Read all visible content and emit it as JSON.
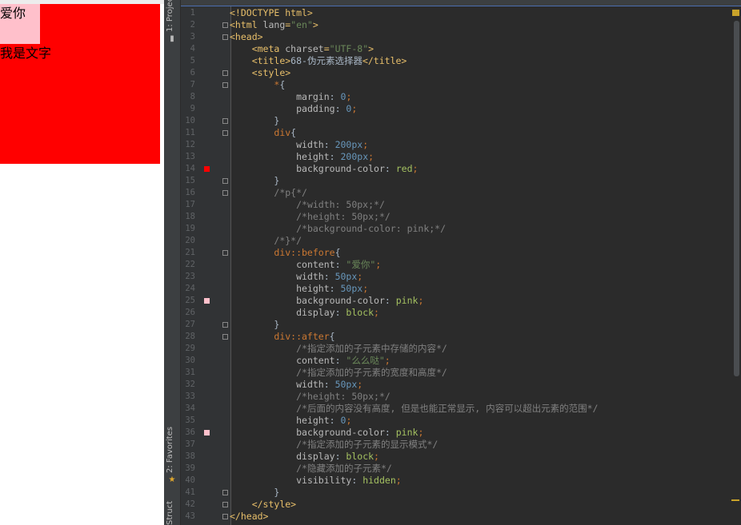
{
  "preview": {
    "before_text": "爱你",
    "div_text": "我是文字"
  },
  "toolstrip": {
    "project_label": "1: Project",
    "favorites_label": "2: Favorites",
    "structure_label": "Structure"
  },
  "colors": {
    "red": "#ff0000",
    "pink": "#ffc0cb"
  },
  "lines": [
    {
      "n": "1",
      "indent": "",
      "tokens": [
        [
          "t-tag",
          "<!DOCTYPE html>"
        ]
      ]
    },
    {
      "n": "2",
      "indent": "",
      "fold": true,
      "tokens": [
        [
          "t-tag",
          "<html "
        ],
        [
          "t-attr",
          "lang"
        ],
        [
          "t-tag",
          "="
        ],
        [
          "t-str",
          "\"en\""
        ],
        [
          "t-tag",
          ">"
        ]
      ]
    },
    {
      "n": "3",
      "indent": "",
      "fold": true,
      "tokens": [
        [
          "t-tag",
          "<head>"
        ]
      ]
    },
    {
      "n": "4",
      "indent": "    ",
      "tokens": [
        [
          "t-tag",
          "<meta "
        ],
        [
          "t-attr",
          "charset"
        ],
        [
          "t-tag",
          "="
        ],
        [
          "t-str",
          "\"UTF-8\""
        ],
        [
          "t-tag",
          ">"
        ]
      ]
    },
    {
      "n": "5",
      "indent": "    ",
      "tokens": [
        [
          "t-tag",
          "<title>"
        ],
        [
          "t-txt",
          "68-伪元素选择器"
        ],
        [
          "t-tag",
          "</title>"
        ]
      ]
    },
    {
      "n": "6",
      "indent": "    ",
      "fold": true,
      "tokens": [
        [
          "t-tag",
          "<style>"
        ]
      ]
    },
    {
      "n": "7",
      "indent": "        ",
      "fold": true,
      "tokens": [
        [
          "t-sel",
          "*"
        ],
        [
          "t-txt",
          "{"
        ]
      ]
    },
    {
      "n": "8",
      "indent": "            ",
      "tokens": [
        [
          "t-prop",
          "margin"
        ],
        [
          "t-txt",
          ": "
        ],
        [
          "t-num",
          "0"
        ],
        [
          "t-punc",
          ";"
        ]
      ]
    },
    {
      "n": "9",
      "indent": "            ",
      "tokens": [
        [
          "t-prop",
          "padding"
        ],
        [
          "t-txt",
          ": "
        ],
        [
          "t-num",
          "0"
        ],
        [
          "t-punc",
          ";"
        ]
      ]
    },
    {
      "n": "10",
      "indent": "        ",
      "fold": true,
      "tokens": [
        [
          "t-txt",
          "}"
        ]
      ]
    },
    {
      "n": "11",
      "indent": "        ",
      "fold": true,
      "tokens": [
        [
          "t-sel",
          "div"
        ],
        [
          "t-txt",
          "{"
        ]
      ]
    },
    {
      "n": "12",
      "indent": "            ",
      "tokens": [
        [
          "t-prop",
          "width"
        ],
        [
          "t-txt",
          ": "
        ],
        [
          "t-num",
          "200px"
        ],
        [
          "t-punc",
          ";"
        ]
      ]
    },
    {
      "n": "13",
      "indent": "            ",
      "tokens": [
        [
          "t-prop",
          "height"
        ],
        [
          "t-txt",
          ": "
        ],
        [
          "t-num",
          "200px"
        ],
        [
          "t-punc",
          ";"
        ]
      ]
    },
    {
      "n": "14",
      "indent": "            ",
      "swatch": "#ff0000",
      "tokens": [
        [
          "t-prop",
          "background-color"
        ],
        [
          "t-txt",
          ": "
        ],
        [
          "t-kw",
          "red"
        ],
        [
          "t-punc",
          ";"
        ]
      ]
    },
    {
      "n": "15",
      "indent": "        ",
      "fold": true,
      "tokens": [
        [
          "t-txt",
          "}"
        ]
      ]
    },
    {
      "n": "16",
      "indent": "        ",
      "fold": true,
      "tokens": [
        [
          "t-com",
          "/*p{*/"
        ]
      ]
    },
    {
      "n": "17",
      "indent": "            ",
      "tokens": [
        [
          "t-com",
          "/*width: 50px;*/"
        ]
      ]
    },
    {
      "n": "18",
      "indent": "            ",
      "tokens": [
        [
          "t-com",
          "/*height: 50px;*/"
        ]
      ]
    },
    {
      "n": "19",
      "indent": "            ",
      "tokens": [
        [
          "t-com",
          "/*background-color: pink;*/"
        ]
      ]
    },
    {
      "n": "20",
      "indent": "        ",
      "tokens": [
        [
          "t-com",
          "/*}*/"
        ]
      ]
    },
    {
      "n": "21",
      "indent": "        ",
      "fold": true,
      "tokens": [
        [
          "t-sel",
          "div::before"
        ],
        [
          "t-txt",
          "{"
        ]
      ]
    },
    {
      "n": "22",
      "indent": "            ",
      "tokens": [
        [
          "t-prop",
          "content"
        ],
        [
          "t-txt",
          ": "
        ],
        [
          "t-str",
          "\"爱你\""
        ],
        [
          "t-punc",
          ";"
        ]
      ]
    },
    {
      "n": "23",
      "indent": "            ",
      "tokens": [
        [
          "t-prop",
          "width"
        ],
        [
          "t-txt",
          ": "
        ],
        [
          "t-num",
          "50px"
        ],
        [
          "t-punc",
          ";"
        ]
      ]
    },
    {
      "n": "24",
      "indent": "            ",
      "tokens": [
        [
          "t-prop",
          "height"
        ],
        [
          "t-txt",
          ": "
        ],
        [
          "t-num",
          "50px"
        ],
        [
          "t-punc",
          ";"
        ]
      ]
    },
    {
      "n": "25",
      "indent": "            ",
      "swatch": "#ffc0cb",
      "tokens": [
        [
          "t-prop",
          "background-color"
        ],
        [
          "t-txt",
          ": "
        ],
        [
          "t-kw",
          "pink"
        ],
        [
          "t-punc",
          ";"
        ]
      ]
    },
    {
      "n": "26",
      "indent": "            ",
      "tokens": [
        [
          "t-prop",
          "display"
        ],
        [
          "t-txt",
          ": "
        ],
        [
          "t-kw",
          "block"
        ],
        [
          "t-punc",
          ";"
        ]
      ]
    },
    {
      "n": "27",
      "indent": "        ",
      "fold": true,
      "tokens": [
        [
          "t-txt",
          "}"
        ]
      ]
    },
    {
      "n": "28",
      "indent": "        ",
      "fold": true,
      "tokens": [
        [
          "t-sel",
          "div::after"
        ],
        [
          "t-txt",
          "{"
        ]
      ]
    },
    {
      "n": "29",
      "indent": "            ",
      "tokens": [
        [
          "t-com",
          "/*指定添加的子元素中存储的内容*/"
        ]
      ]
    },
    {
      "n": "30",
      "indent": "            ",
      "tokens": [
        [
          "t-prop",
          "content"
        ],
        [
          "t-txt",
          ": "
        ],
        [
          "t-str",
          "\"么么哒\""
        ],
        [
          "t-punc",
          ";"
        ]
      ]
    },
    {
      "n": "31",
      "indent": "            ",
      "tokens": [
        [
          "t-com",
          "/*指定添加的子元素的宽度和高度*/"
        ]
      ]
    },
    {
      "n": "32",
      "indent": "            ",
      "tokens": [
        [
          "t-prop",
          "width"
        ],
        [
          "t-txt",
          ": "
        ],
        [
          "t-num",
          "50px"
        ],
        [
          "t-punc",
          ";"
        ]
      ]
    },
    {
      "n": "33",
      "indent": "            ",
      "tokens": [
        [
          "t-com",
          "/*height: 50px;*/"
        ]
      ]
    },
    {
      "n": "34",
      "indent": "            ",
      "tokens": [
        [
          "t-com",
          "/*后面的内容没有高度, 但是也能正常显示, 内容可以超出元素的范围*/"
        ]
      ]
    },
    {
      "n": "35",
      "indent": "            ",
      "tokens": [
        [
          "t-prop",
          "height"
        ],
        [
          "t-txt",
          ": "
        ],
        [
          "t-num",
          "0"
        ],
        [
          "t-punc",
          ";"
        ]
      ]
    },
    {
      "n": "36",
      "indent": "            ",
      "swatch": "#ffc0cb",
      "tokens": [
        [
          "t-prop",
          "background-color"
        ],
        [
          "t-txt",
          ": "
        ],
        [
          "t-kw",
          "pink"
        ],
        [
          "t-punc",
          ";"
        ]
      ]
    },
    {
      "n": "37",
      "indent": "            ",
      "tokens": [
        [
          "t-com",
          "/*指定添加的子元素的显示模式*/"
        ]
      ]
    },
    {
      "n": "38",
      "indent": "            ",
      "tokens": [
        [
          "t-prop",
          "display"
        ],
        [
          "t-txt",
          ": "
        ],
        [
          "t-kw",
          "block"
        ],
        [
          "t-punc",
          ";"
        ]
      ]
    },
    {
      "n": "39",
      "indent": "            ",
      "tokens": [
        [
          "t-com",
          "/*隐藏添加的子元素*/"
        ]
      ]
    },
    {
      "n": "40",
      "indent": "            ",
      "tokens": [
        [
          "t-prop",
          "visibility"
        ],
        [
          "t-txt",
          ": "
        ],
        [
          "t-kw",
          "hidden"
        ],
        [
          "t-punc",
          ";"
        ]
      ]
    },
    {
      "n": "41",
      "indent": "        ",
      "fold": true,
      "tokens": [
        [
          "t-txt",
          "}"
        ]
      ]
    },
    {
      "n": "42",
      "indent": "    ",
      "fold": true,
      "tokens": [
        [
          "t-tag",
          "</style>"
        ]
      ]
    },
    {
      "n": "43",
      "indent": "",
      "fold": true,
      "tokens": [
        [
          "t-tag",
          "</head>"
        ]
      ]
    }
  ]
}
